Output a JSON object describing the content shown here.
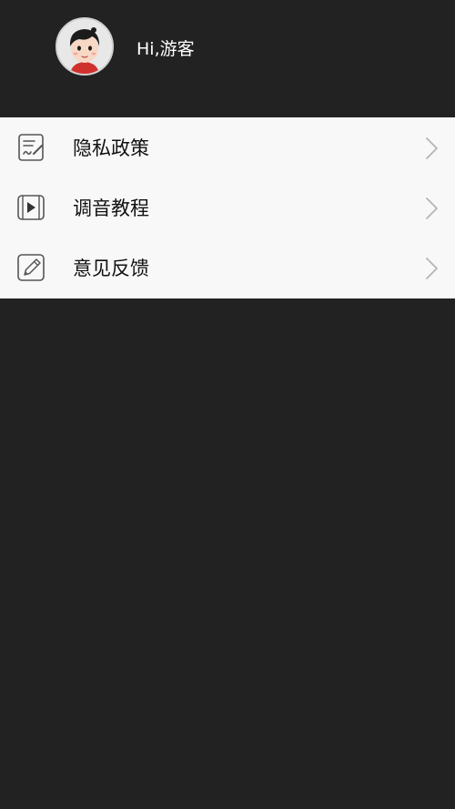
{
  "header": {
    "greeting": "Hi,游客",
    "avatar_icon": "cartoon-avatar-icon"
  },
  "menu": {
    "items": [
      {
        "label": "隐私政策",
        "icon": "document-sign-icon"
      },
      {
        "label": "调音教程",
        "icon": "video-play-icon"
      },
      {
        "label": "意见反馈",
        "icon": "edit-pencil-icon"
      }
    ],
    "chevron_icon": "chevron-right-icon"
  },
  "colors": {
    "background": "#222222",
    "menu_background": "#f8f8f8",
    "text_primary": "#111111",
    "greeting_text": "#ffffff",
    "chevron": "#b5b5b5",
    "icon_stroke": "#555555"
  }
}
